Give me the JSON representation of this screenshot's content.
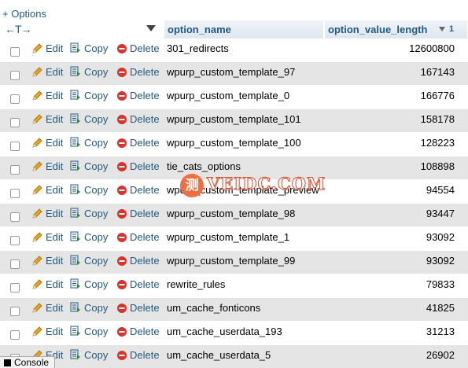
{
  "top": {
    "options_label": "+ Options"
  },
  "header": {
    "resize_glyph": "←T→",
    "col_name": "option_name",
    "col_length": "option_value_length",
    "sort_index": "1"
  },
  "actions": {
    "edit": "Edit",
    "copy": "Copy",
    "delete": "Delete"
  },
  "icons": {
    "edit": "pencil-icon",
    "copy": "copy-icon",
    "delete": "delete-icon",
    "sort": "sort-arrow-icon",
    "console": "console-icon"
  },
  "colors": {
    "link": "#235a81",
    "row_alt": "#e5e5e5",
    "delete_icon": "#d9342b",
    "pencil": "#e8a41c"
  },
  "rows": [
    {
      "name": "301_redirects",
      "length": "12600800"
    },
    {
      "name": "wpurp_custom_template_97",
      "length": "167143"
    },
    {
      "name": "wpurp_custom_template_0",
      "length": "166776"
    },
    {
      "name": "wpurp_custom_template_101",
      "length": "158178"
    },
    {
      "name": "wpurp_custom_template_100",
      "length": "128223"
    },
    {
      "name": "tie_cats_options",
      "length": "108898"
    },
    {
      "name": "wpurp_custom_template_preview",
      "length": "94554"
    },
    {
      "name": "wpurp_custom_template_98",
      "length": "93447"
    },
    {
      "name": "wpurp_custom_template_1",
      "length": "93092"
    },
    {
      "name": "wpurp_custom_template_99",
      "length": "93092"
    },
    {
      "name": "rewrite_rules",
      "length": "79833"
    },
    {
      "name": "um_cache_fonticons",
      "length": "41825"
    },
    {
      "name": "um_cache_userdata_193",
      "length": "31213"
    },
    {
      "name": "um_cache_userdata_5",
      "length": "26902"
    }
  ],
  "watermark": {
    "glyph": "测",
    "text": "VEIDC.COM"
  },
  "console": {
    "label": "Console"
  }
}
